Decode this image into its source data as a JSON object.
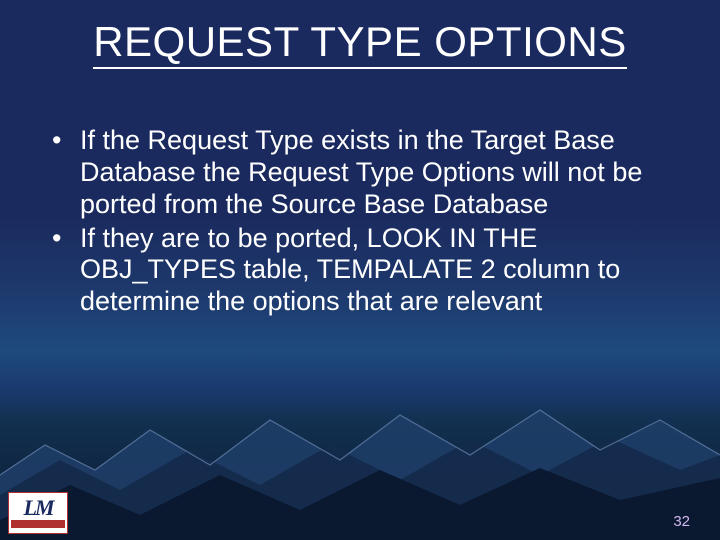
{
  "title": "REQUEST TYPE OPTIONS",
  "bullets": [
    "If the Request Type exists in the Target Base Database the Request Type Options will not be ported from the Source Base Database",
    "If they are to be ported, LOOK IN THE OBJ_TYPES table, TEMPALATE 2 column to determine the options that are relevant"
  ],
  "logo": {
    "main": "LM",
    "sub": ""
  },
  "page_number": "32"
}
